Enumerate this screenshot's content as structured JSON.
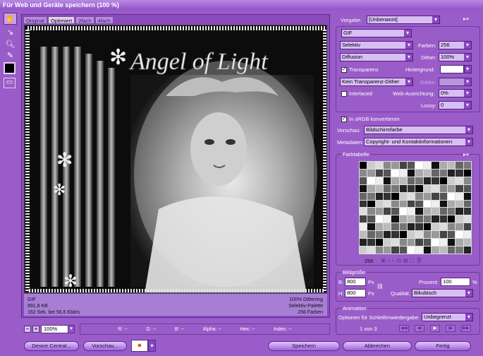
{
  "window": {
    "title": "Für Web und Geräte speichern (100 %)"
  },
  "tabs": [
    "Original",
    "Optimiert",
    "2fach",
    "4fach"
  ],
  "preview": {
    "image_text": "Angel of Light"
  },
  "info": {
    "format": "GIF",
    "size": "891,8 KB",
    "time": "162 Sek. bei 56,6 Kbit/s",
    "dithering": "100% Dithering",
    "palette": "Selektiv-Palette",
    "colors": "256 Farben"
  },
  "zoom": "100%",
  "readout": {
    "r": "R: --",
    "g": "G: --",
    "b": "B: --",
    "alpha": "Alpha: --",
    "hex": "Hex: --",
    "index": "Index: --"
  },
  "settings": {
    "preset_label": "Vorgabe:",
    "preset_value": "[Unbenannt]",
    "format": "GIF",
    "reduction": "Selektiv",
    "colors_label": "Farben:",
    "colors_value": "256",
    "dither_algo": "Diffusion",
    "dither_label": "Dither:",
    "dither_value": "100%",
    "transparency_label": "Transparenz",
    "matte_label": "Hintergrund:",
    "transp_dither": "Kein Transparenz-Dither",
    "amount_label": "Stärke:",
    "interlaced_label": "Interlaced",
    "websnap_label": "Web-Ausrichtung:",
    "websnap_value": "0%",
    "lossy_label": "Lossy:",
    "lossy_value": "0",
    "srgb_label": "In sRGB konvertieren",
    "preview_label": "Vorschau:",
    "preview_value": "Bildschirmfarbe",
    "metadata_label": "Metadaten:",
    "metadata_value": "Copyright- und Kontaktinformationen"
  },
  "color_table": {
    "title": "Farbtabelle",
    "count": "256"
  },
  "image_size": {
    "title": "Bildgröße",
    "w_label": "B:",
    "w_value": "800",
    "h_label": "H:",
    "h_value": "800",
    "unit": "Px",
    "percent_label": "Prozent:",
    "percent_value": "100",
    "percent_unit": "%",
    "quality_label": "Qualität:",
    "quality_value": "Bikubisch"
  },
  "animation": {
    "title": "Animation",
    "loop_label": "Optionen für Schleifenwiedergabe:",
    "loop_value": "Unbegrenzt",
    "frame": "1 von 3"
  },
  "buttons": {
    "device_central": "Device Central...",
    "preview": "Vorschau...",
    "save": "Speichern",
    "cancel": "Abbrechen",
    "done": "Fertig"
  },
  "colors": {
    "bg": "#9a5cc8",
    "accent": "#8a46c2"
  }
}
